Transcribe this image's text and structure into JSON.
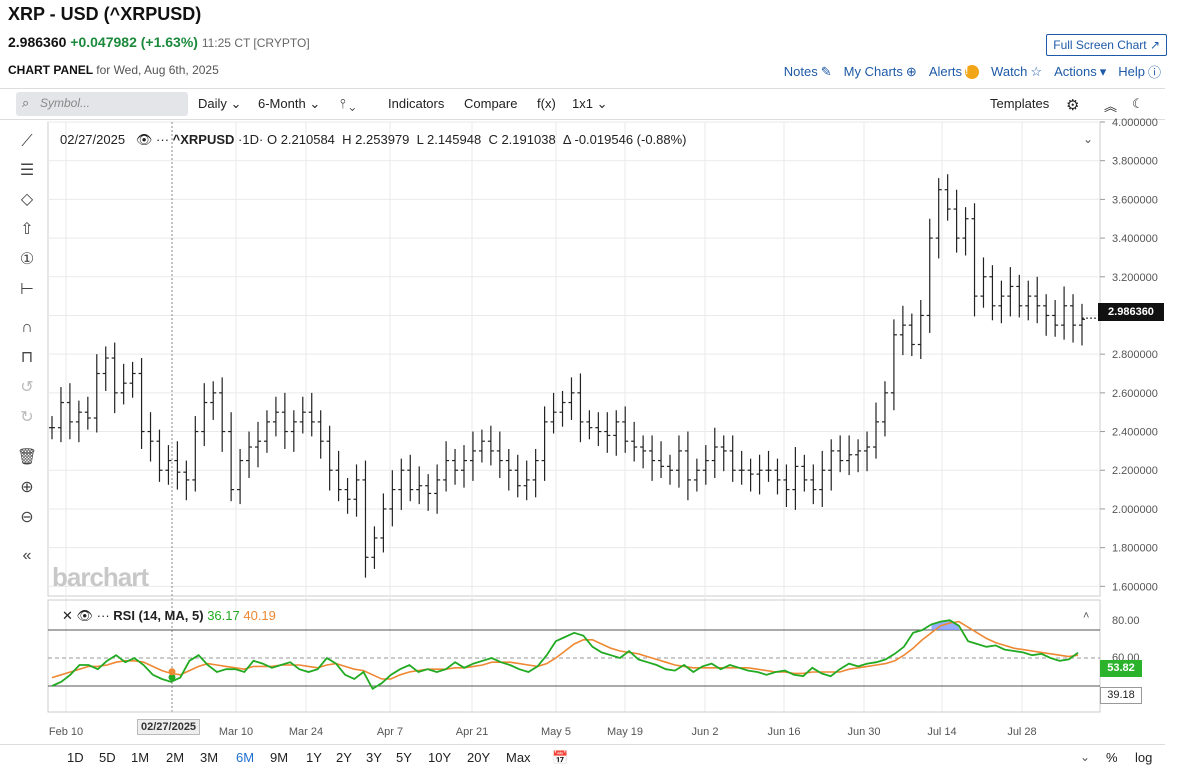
{
  "header": {
    "title": "XRP - USD (^XRPUSD)",
    "last": "2.986360",
    "change": "+0.047982 (+1.63%)",
    "time": "11:25 CT [CRYPTO]",
    "panel_label": "CHART PANEL",
    "panel_date": "for Wed, Aug 6th, 2025",
    "fullscreen": "Full Screen Chart ↗"
  },
  "links": {
    "notes": "Notes",
    "mycharts": "My Charts",
    "alerts": "Alerts",
    "watch": "Watch",
    "actions": "Actions",
    "help": "Help"
  },
  "toolbar": {
    "search_placeholder": "Symbol...",
    "interval": "Daily",
    "period": "6-Month",
    "indicators": "Indicators",
    "compare": "Compare",
    "fx": "f(x)",
    "layout": "1x1",
    "templates": "Templates"
  },
  "info": {
    "date": "02/27/2025",
    "symbol": "^XRPUSD",
    "interval": "1D",
    "open": "O 2.210584",
    "high": "H 2.253979",
    "low": "L 2.145948",
    "close": "C 2.191038",
    "change": "Δ -0.019546 (-0.88%)"
  },
  "rsi": {
    "label": "RSI (14, MA, 5)",
    "value": "36.17",
    "ma": "40.19",
    "tag_current": "53.82",
    "tag_ma": "39.18",
    "levels": [
      "80.00",
      "60.00"
    ]
  },
  "colors": {
    "rsi": "#22aa22",
    "rsi_ma": "#ee8833",
    "link": "#1e5aa8",
    "price_tag": "#111111"
  },
  "watermark": "barchart",
  "price_tag": "2.986360",
  "hover_date": "02/27/2025",
  "ranges": [
    "1D",
    "5D",
    "1M",
    "2M",
    "3M",
    "6M",
    "9M",
    "1Y",
    "2Y",
    "3Y",
    "5Y",
    "10Y",
    "20Y",
    "Max"
  ],
  "active_range": "6M",
  "bottom_right": {
    "percent": "%",
    "log": "log"
  },
  "chart_data": {
    "type": "ohlc",
    "y_ticks": [
      "4.000000",
      "3.800000",
      "3.600000",
      "3.400000",
      "3.200000",
      "3.000000",
      "2.800000",
      "2.600000",
      "2.400000",
      "2.200000",
      "2.000000",
      "1.800000",
      "1.600000"
    ],
    "ylim": [
      1.55,
      4.0
    ],
    "x_ticks": [
      "Feb 10",
      "Mar 10",
      "Mar 24",
      "Apr 7",
      "Apr 21",
      "May 5",
      "May 19",
      "Jun 2",
      "Jun 16",
      "Jun 30",
      "Jul 14",
      "Jul 28"
    ],
    "close": [
      2.42,
      2.55,
      2.45,
      2.5,
      2.47,
      2.7,
      2.78,
      2.6,
      2.65,
      2.7,
      2.4,
      2.35,
      2.2,
      2.25,
      2.19,
      2.15,
      2.4,
      2.55,
      2.6,
      2.4,
      2.1,
      2.25,
      2.32,
      2.35,
      2.45,
      2.5,
      2.4,
      2.45,
      2.5,
      2.45,
      2.35,
      2.2,
      2.1,
      2.05,
      2.15,
      1.75,
      1.85,
      2.0,
      2.1,
      2.2,
      2.1,
      2.12,
      2.08,
      2.15,
      2.25,
      2.2,
      2.25,
      2.3,
      2.35,
      2.3,
      2.25,
      2.2,
      2.12,
      2.15,
      2.25,
      2.45,
      2.5,
      2.55,
      2.6,
      2.45,
      2.42,
      2.4,
      2.38,
      2.45,
      2.35,
      2.32,
      2.3,
      2.25,
      2.22,
      2.2,
      2.3,
      2.15,
      2.2,
      2.25,
      2.32,
      2.3,
      2.2,
      2.2,
      2.18,
      2.2,
      2.2,
      2.15,
      2.1,
      2.22,
      2.15,
      2.1,
      2.2,
      2.3,
      2.25,
      2.28,
      2.3,
      2.32,
      2.45,
      2.6,
      2.9,
      2.95,
      2.85,
      3.0,
      3.4,
      3.65,
      3.55,
      3.4,
      3.5,
      3.1,
      3.2,
      3.05,
      3.1,
      3.15,
      3.05,
      3.1,
      3.05,
      3.0,
      2.95,
      3.05,
      2.95,
      2.98
    ],
    "rsi": [
      30,
      33,
      38,
      45,
      45,
      42,
      48,
      52,
      47,
      50,
      45,
      38,
      35,
      33,
      36,
      48,
      52,
      45,
      40,
      42,
      42,
      40,
      48,
      46,
      43,
      45,
      47,
      42,
      40,
      42,
      50,
      46,
      38,
      35,
      40,
      28,
      32,
      38,
      42,
      45,
      40,
      42,
      40,
      42,
      47,
      43,
      46,
      48,
      50,
      47,
      45,
      42,
      40,
      44,
      52,
      62,
      65,
      68,
      66,
      58,
      54,
      52,
      50,
      55,
      49,
      47,
      45,
      42,
      41,
      45,
      40,
      44,
      46,
      42,
      45,
      43,
      41,
      40,
      38,
      40,
      41,
      38,
      37,
      43,
      39,
      37,
      42,
      46,
      44,
      46,
      47,
      49,
      53,
      58,
      68,
      70,
      74,
      76,
      77,
      73,
      62,
      60,
      58,
      59,
      56,
      55,
      54,
      52,
      53,
      50,
      48,
      49,
      53.82
    ],
    "rsi_ma": [
      36,
      38,
      40,
      42,
      44,
      44,
      45,
      47,
      48,
      48,
      47,
      44,
      41,
      39,
      38,
      41,
      44,
      46,
      45,
      44,
      43,
      42,
      44,
      44,
      44,
      45,
      45,
      45,
      44,
      43,
      45,
      46,
      44,
      42,
      41,
      38,
      35,
      35,
      38,
      40,
      41,
      42,
      42,
      42,
      43,
      43,
      44,
      45,
      47,
      47,
      47,
      46,
      45,
      44,
      46,
      50,
      55,
      60,
      63,
      63,
      60,
      57,
      55,
      54,
      53,
      51,
      49,
      47,
      45,
      44,
      43,
      43,
      43,
      43,
      43,
      43,
      43,
      42,
      41,
      40,
      40,
      39,
      39,
      40,
      40,
      40,
      40,
      42,
      43,
      44,
      45,
      46,
      48,
      52,
      57,
      63,
      68,
      73,
      75,
      76,
      72,
      68,
      64,
      61,
      59,
      57,
      56,
      55,
      54,
      53,
      52,
      51,
      52
    ]
  }
}
